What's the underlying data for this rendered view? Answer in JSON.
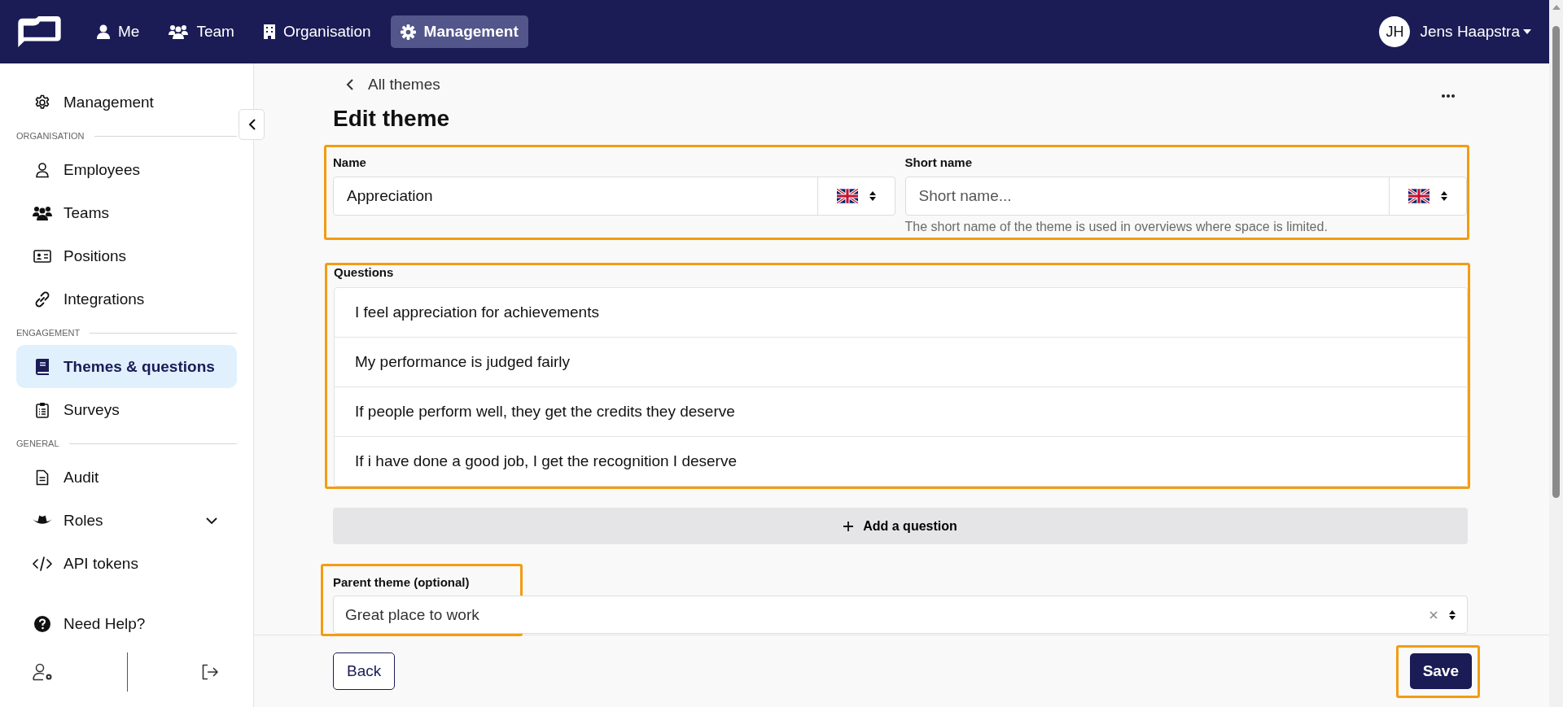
{
  "nav": {
    "items": [
      {
        "label": "Me",
        "selected": false
      },
      {
        "label": "Team",
        "selected": false
      },
      {
        "label": "Organisation",
        "selected": false
      },
      {
        "label": "Management",
        "selected": true
      }
    ],
    "user": {
      "initials": "JH",
      "name": "Jens Haapstra"
    }
  },
  "sidebar": {
    "top": {
      "label": "Management",
      "selected": false
    },
    "groups": [
      {
        "heading": "ORGANISATION",
        "items": [
          {
            "label": "Employees",
            "selected": false
          },
          {
            "label": "Teams",
            "selected": false
          },
          {
            "label": "Positions",
            "selected": false
          },
          {
            "label": "Integrations",
            "selected": false
          }
        ]
      },
      {
        "heading": "ENGAGEMENT",
        "items": [
          {
            "label": "Themes & questions",
            "selected": true
          },
          {
            "label": "Surveys",
            "selected": false
          }
        ]
      },
      {
        "heading": "GENERAL",
        "items": [
          {
            "label": "Audit",
            "selected": false
          },
          {
            "label": "Roles",
            "selected": false,
            "expanded": false
          },
          {
            "label": "API tokens",
            "selected": false
          }
        ]
      }
    ],
    "help": "Need Help?"
  },
  "page": {
    "back_link": "All themes",
    "title": "Edit theme",
    "name": {
      "label": "Name",
      "value": "Appreciation"
    },
    "short_name": {
      "label": "Short name",
      "placeholder": "Short name...",
      "hint": "The short name of the theme is used in overviews where space is limited."
    },
    "questions": {
      "label": "Questions",
      "items": [
        "I feel appreciation for achievements",
        "My performance is judged fairly",
        "If people perform well, they get the credits they deserve",
        "If i have done a good job, I get the recognition I deserve"
      ]
    },
    "add_button": "Add a question",
    "parent": {
      "label": "Parent theme (optional)",
      "value": "Great place to work"
    }
  },
  "footer": {
    "back": "Back",
    "save": "Save"
  }
}
